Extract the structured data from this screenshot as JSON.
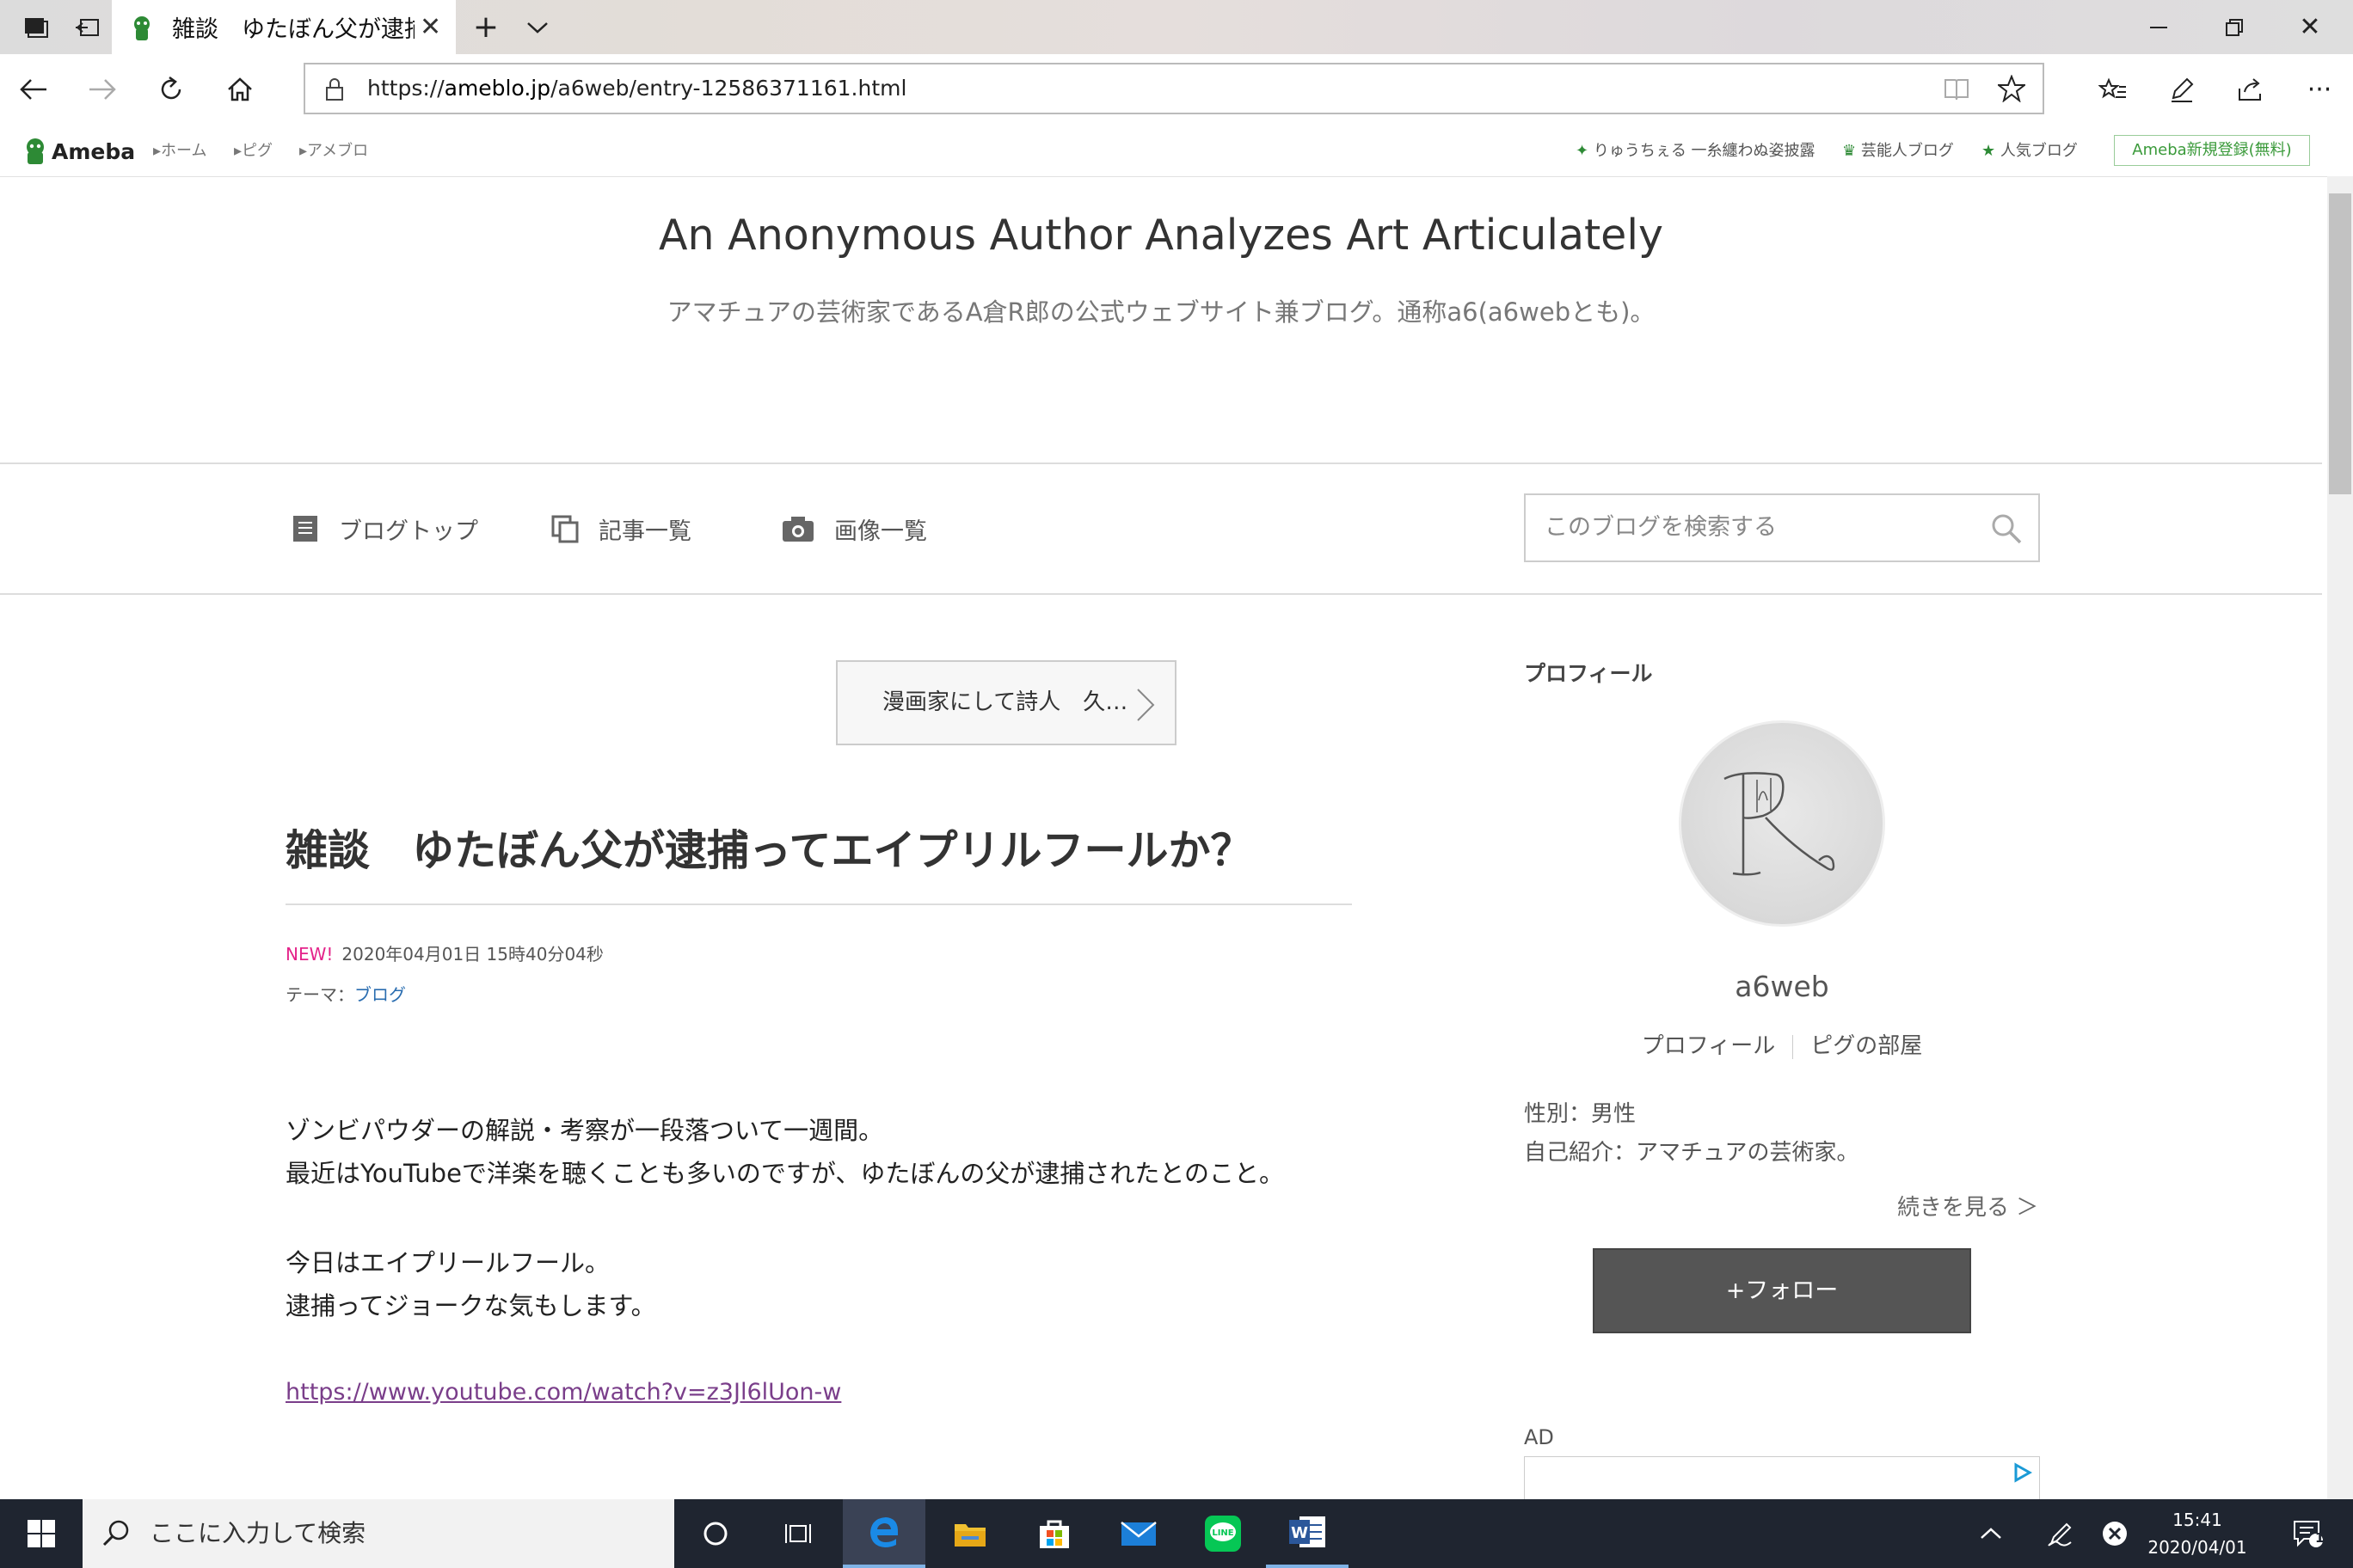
{
  "browser": {
    "tab_title": "雑談　ゆたぼん父が逮捕:",
    "url_prefix": "https://",
    "url_host": "ameblo.jp",
    "url_path": "/a6web/entry-12586371161.html"
  },
  "ameba": {
    "logo_text": "Ameba",
    "crumbs": [
      "ホーム",
      "ピグ",
      "アメブロ"
    ],
    "header_links": [
      "りゅうちぇる 一糸纏わぬ姿披露",
      "芸能人ブログ",
      "人気ブログ"
    ],
    "signup_label": "Ameba新規登録(無料)"
  },
  "blog": {
    "title": "An Anonymous Author Analyzes Art Articulately",
    "description": "アマチュアの芸術家であるA倉R郎の公式ウェブサイト兼ブログ。通称a6(a6webとも)。",
    "nav": [
      "ブログトップ",
      "記事一覧",
      "画像一覧"
    ],
    "search_placeholder": "このブログを検索する"
  },
  "entry": {
    "prev_label": "漫画家にして詩人　久…",
    "title": "雑談　ゆたぼん父が逮捕ってエイプリルフールか？",
    "new_badge": "NEW!",
    "datetime": "2020年04月01日 15時40分04秒",
    "theme_label": "テーマ：",
    "theme_value": "ブログ",
    "paragraphs": [
      "ゾンビパウダーの解説・考察が一段落ついて一週間。",
      "最近はYouTubeで洋楽を聴くことも多いのですが、ゆたぼんの父が逮捕されたとのこと。",
      "今日はエイプリールフール。",
      "逮捕ってジョークな気もします。"
    ],
    "link": "https://www.youtube.com/watch?v=z3Jl6lUon-w"
  },
  "sidebar": {
    "heading": "プロフィール",
    "username": "a6web",
    "profile_link": "プロフィール",
    "pig_link": "ピグの部屋",
    "sex": "性別：男性",
    "intro": "自己紹介：アマチュアの芸術家。",
    "more": "続きを見る ＞",
    "follow": "+フォロー",
    "ad_label": "AD"
  },
  "taskbar": {
    "search_placeholder": "ここに入力して検索",
    "time": "15:41",
    "date": "2020/04/01",
    "notification_count": "1"
  },
  "colors": {
    "ameba_green": "#2d8a35",
    "new_pink": "#e4238a",
    "theme_link": "#2a6db0",
    "visited_link": "#7a3e8a",
    "follow_bg": "#555555",
    "taskbar_bg": "#1f2530"
  }
}
